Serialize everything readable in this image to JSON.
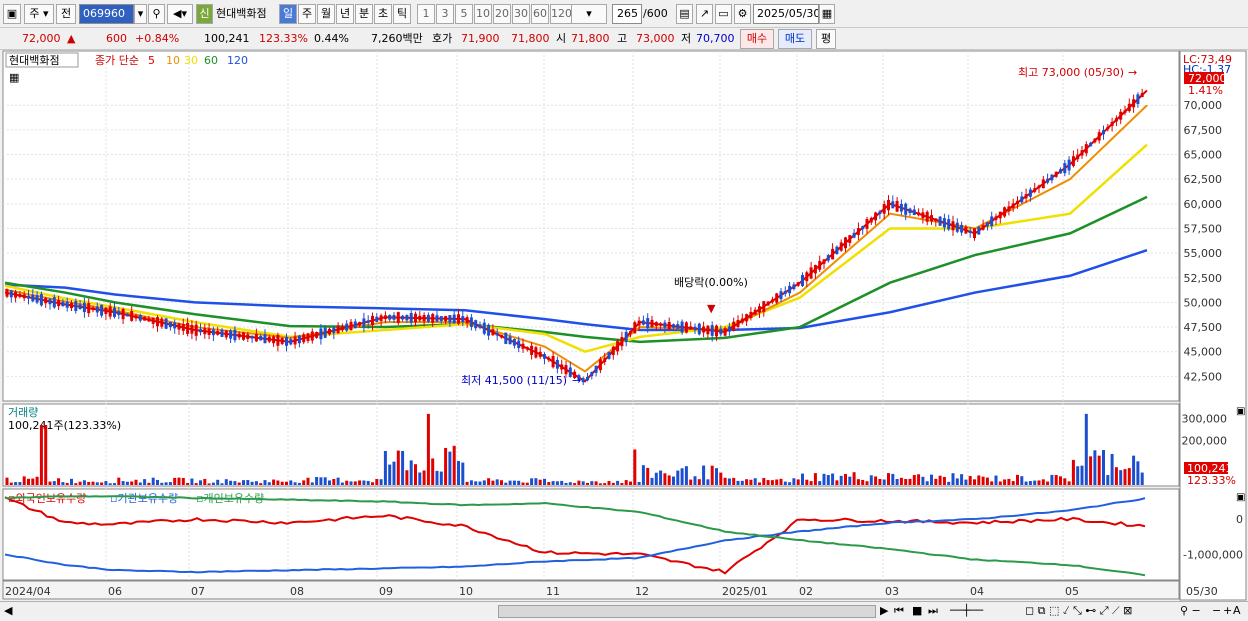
{
  "toolbar": {
    "period_unit": "주",
    "compare": "전",
    "code": "069960",
    "badge": "신",
    "name": "현대백화점",
    "tabs": [
      "일",
      "주",
      "월",
      "년",
      "분",
      "초",
      "틱"
    ],
    "periods": [
      "1",
      "3",
      "5",
      "10",
      "20",
      "30",
      "60",
      "120"
    ],
    "count": "265",
    "count_total": "/600",
    "date": "2025/05/30"
  },
  "infobar": {
    "price": "72,000",
    "arrow": "▲",
    "change": "600",
    "change_pct": "+0.84%",
    "volume": "100,241",
    "volume_ratio": "123.33%",
    "turnover": "0.44%",
    "value": "7,260백만",
    "hoga_label": "호가",
    "ask": "71,900",
    "bid": "71,800",
    "open_label": "시",
    "open": "71,800",
    "high_label": "고",
    "high": "73,000",
    "low_label": "저",
    "low": "70,700",
    "buy": "매수",
    "sell": "매도",
    "eval": "평"
  },
  "colors": {
    "up": "#e00000",
    "down": "#1c4fd0",
    "ma5": "#e00000",
    "ma10": "#f08c00",
    "ma30": "#f0e000",
    "ma60": "#1e9028",
    "ma120": "#2050e8",
    "foreign": "#e00000",
    "institution": "#2060e0",
    "individual": "#2a9a4a"
  },
  "chart_data": [
    {
      "type": "candlestick",
      "title": "현대백화점",
      "legend": {
        "label": "종가 단순",
        "periods": [
          "5",
          "10",
          "30",
          "60",
          "120"
        ]
      },
      "y_ticks": [
        "70,000",
        "67,500",
        "65,000",
        "62,500",
        "60,000",
        "57,500",
        "55,000",
        "52,500",
        "50,000",
        "47,500",
        "45,000",
        "42,500"
      ],
      "ylim": [
        40000,
        75500
      ],
      "x_labels": [
        "2024/04",
        "06",
        "07",
        "08",
        "09",
        "10",
        "11",
        "12",
        "2025/01",
        "02",
        "03",
        "04",
        "05",
        "05/30"
      ],
      "x": [
        "2024-04",
        "2024-05",
        "2024-06",
        "2024-07",
        "2024-08",
        "2024-09",
        "2024-10",
        "2024-11",
        "2024-11-15",
        "2024-12",
        "2025-01",
        "2025-02",
        "2025-03",
        "2025-04",
        "2025-05",
        "2025-05-30"
      ],
      "series": [
        {
          "name": "5",
          "values": [
            51000,
            49800,
            49000,
            47200,
            46000,
            48500,
            48300,
            44500,
            42000,
            48000,
            47000,
            52000,
            60000,
            57000,
            64000,
            71500
          ]
        },
        {
          "name": "10",
          "values": [
            51300,
            50100,
            49200,
            47500,
            46400,
            48000,
            48000,
            45500,
            43000,
            47500,
            47200,
            51000,
            59000,
            57500,
            62500,
            70000
          ]
        },
        {
          "name": "30",
          "values": [
            51700,
            50400,
            49500,
            48000,
            46500,
            47200,
            47800,
            46800,
            45000,
            46500,
            47500,
            50500,
            57500,
            57500,
            59000,
            66000
          ]
        },
        {
          "name": "60",
          "values": [
            52000,
            51000,
            50000,
            48800,
            47600,
            47500,
            47800,
            47000,
            46500,
            46000,
            46400,
            47500,
            52000,
            54800,
            57000,
            60700
          ]
        },
        {
          "name": "120",
          "values": [
            51800,
            51500,
            50800,
            50000,
            49600,
            49400,
            49200,
            48300,
            47800,
            47200,
            47200,
            47400,
            49000,
            51000,
            52700,
            55300
          ]
        }
      ],
      "current_price": "72,000",
      "current_change": "1.41%",
      "lc_label": "LC:73,49",
      "hc_label": "HC:-1.37",
      "annotations": {
        "high": "최고 73,000 (05/30)",
        "low": "최저 41,500 (11/15)",
        "dividend": "배당락(0.00%)"
      }
    },
    {
      "type": "bar",
      "title": "거래량",
      "summary": "100,241주(123.33%)",
      "y_ticks": [
        "300,000",
        "200,000"
      ],
      "ylim": [
        0,
        360000
      ],
      "current": "100,241",
      "current_pct": "123.33%",
      "x": [
        "2024-04",
        "2024-05",
        "2024-06",
        "2024-07",
        "2024-08",
        "2024-09",
        "2024-10",
        "2024-11",
        "2024-12",
        "2025-01",
        "2025-02",
        "2025-03",
        "2025-04",
        "2025-05",
        "2025-05-30"
      ],
      "values": [
        70000,
        55000,
        60000,
        50000,
        65000,
        320000,
        55000,
        45000,
        160000,
        60000,
        110000,
        95000,
        85000,
        320000,
        100241
      ]
    },
    {
      "type": "line",
      "series_labels": [
        "외국인보유수량",
        "기관보유수량",
        "개인보유수량"
      ],
      "y_ticks": [
        "0",
        "-1,000,000"
      ],
      "ylim": [
        -1700000,
        800000
      ],
      "x": [
        "2024-04",
        "2024-05",
        "2024-06",
        "2024-07",
        "2024-08",
        "2024-09",
        "2024-10",
        "2024-11",
        "2024-12",
        "2025-01",
        "2025-02",
        "2025-03",
        "2025-04",
        "2025-05",
        "2025-05-30"
      ],
      "series": [
        {
          "name": "외국인보유수량",
          "values": [
            600000,
            -100000,
            -150000,
            0,
            -100000,
            100000,
            -200000,
            -950000,
            -1000000,
            -1500000,
            0,
            -50000,
            -100000,
            0,
            -200000
          ]
        },
        {
          "name": "기관보유수량",
          "values": [
            -1000000,
            -1300000,
            -1450000,
            -1500000,
            -1450000,
            -1400000,
            -1350000,
            -1200000,
            -1100000,
            -600000,
            -350000,
            -100000,
            0,
            250000,
            600000
          ]
        },
        {
          "name": "개인보유수량",
          "values": [
            600000,
            650000,
            650000,
            600000,
            550000,
            500000,
            400000,
            450000,
            200000,
            -350000,
            -600000,
            -850000,
            -1150000,
            -1300000,
            -1600000
          ]
        }
      ]
    }
  ]
}
